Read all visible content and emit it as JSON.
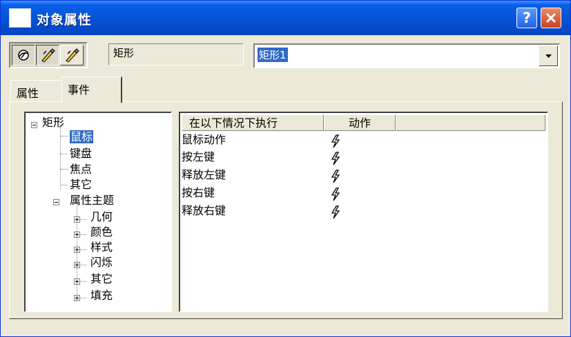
{
  "window": {
    "title": "对象属性"
  },
  "toolbar": {
    "buttons": [
      {
        "icon": "pointer-ball-icon"
      },
      {
        "icon": "pencil-edit-icon"
      },
      {
        "icon": "pencil-edit-icon-alt"
      }
    ],
    "type_label": "矩形",
    "object_name": "矩形1"
  },
  "tabs": [
    {
      "label": "属性",
      "active": false
    },
    {
      "label": "事件",
      "active": true
    }
  ],
  "tree": {
    "root": "矩形",
    "children": [
      "鼠标",
      "键盘",
      "焦点",
      "其它"
    ],
    "group": "属性主题",
    "group_children": [
      "几何",
      "颜色",
      "样式",
      "闪烁",
      "其它",
      "填充"
    ],
    "selected": "鼠标"
  },
  "events": {
    "columns": [
      "在以下情况下执行",
      "动作"
    ],
    "rows": [
      {
        "condition": "鼠标动作",
        "action_icon": "lightning-icon"
      },
      {
        "condition": "按左键",
        "action_icon": "lightning-icon"
      },
      {
        "condition": "释放左键",
        "action_icon": "lightning-icon"
      },
      {
        "condition": "按右键",
        "action_icon": "lightning-icon"
      },
      {
        "condition": "释放右键",
        "action_icon": "lightning-icon"
      }
    ]
  },
  "colors": {
    "titlebar": "#0450d2",
    "selection": "#316ac5",
    "face": "#ece9d8"
  }
}
